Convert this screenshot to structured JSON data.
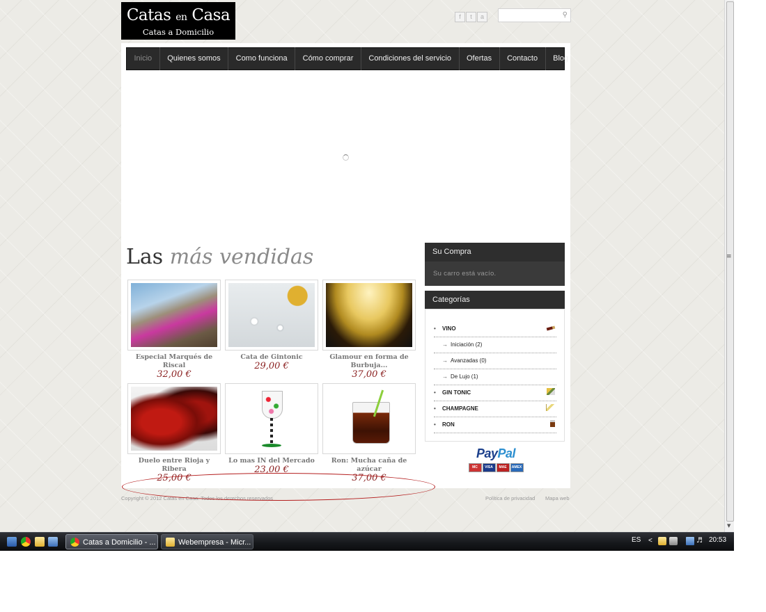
{
  "header": {
    "logo_title_part1": "Catas",
    "logo_title_en": "en",
    "logo_title_part2": "Casa",
    "logo_subtitle": "Catas a Domicilio",
    "social": [
      {
        "icon": "facebook-icon",
        "glyph": "f"
      },
      {
        "icon": "twitter-icon",
        "glyph": "t"
      },
      {
        "icon": "rss-icon",
        "glyph": "a"
      }
    ],
    "search_placeholder": ""
  },
  "nav": {
    "items": [
      "Inicio",
      "Quienes somos",
      "Como funciona",
      "Cómo comprar",
      "Condiciones del servicio",
      "Ofertas",
      "Contacto",
      "Blog"
    ],
    "active": "Inicio"
  },
  "section": {
    "title_plain": "Las",
    "title_accent": "más vendidas"
  },
  "products": [
    {
      "name": "Especial Marqués de Riscal",
      "price": "32,00 €"
    },
    {
      "name": "Cata de Gintonic",
      "price": "29,00 €"
    },
    {
      "name": "Glamour en forma de Burbuja...",
      "price": "37,00 €"
    },
    {
      "name": "Duelo entre Rioja y Ribera",
      "price": "25,00 €"
    },
    {
      "name": "Lo mas IN del Mercado",
      "price": "23,00 €"
    },
    {
      "name": "Ron: Mucha caña de azúcar",
      "price": "37,00 €"
    }
  ],
  "cart": {
    "title": "Su Compra",
    "empty_text": "Su carro está vacío."
  },
  "categories": {
    "title": "Categorías",
    "items": [
      {
        "label": "VINO",
        "level": "main"
      },
      {
        "label": "Iniciación (2)",
        "level": "sub"
      },
      {
        "label": "Avanzadas (0)",
        "level": "sub"
      },
      {
        "label": "De Lujo (1)",
        "level": "sub"
      },
      {
        "label": "GIN TONIC",
        "level": "main"
      },
      {
        "label": "CHAMPAGNE",
        "level": "main"
      },
      {
        "label": "RON",
        "level": "main"
      }
    ]
  },
  "payment": {
    "pay": "Pay",
    "pal": "Pal",
    "cards": [
      "MC",
      "VISA",
      "MAE",
      "AMEX"
    ]
  },
  "footer": {
    "copyright": "Copyright © 2012 Catas en Casa. Todos los derechos reservados",
    "privacy": "Política de privacidad",
    "sitemap": "Mapa web"
  },
  "taskbar": {
    "tasks": [
      {
        "label": "Catas a Domicilio - ...",
        "icon": "chrome-icon",
        "active": true
      },
      {
        "label": "Webempresa - Micr...",
        "icon": "mail-icon",
        "active": false
      }
    ],
    "language": "ES",
    "clock": "20:53"
  },
  "colors": {
    "price": "#8b2121",
    "nav_bg": "#2a2a2a",
    "paypal_dark": "#1b3f8b",
    "paypal_light": "#2c8fd0",
    "annotation": "#b41d1d"
  }
}
